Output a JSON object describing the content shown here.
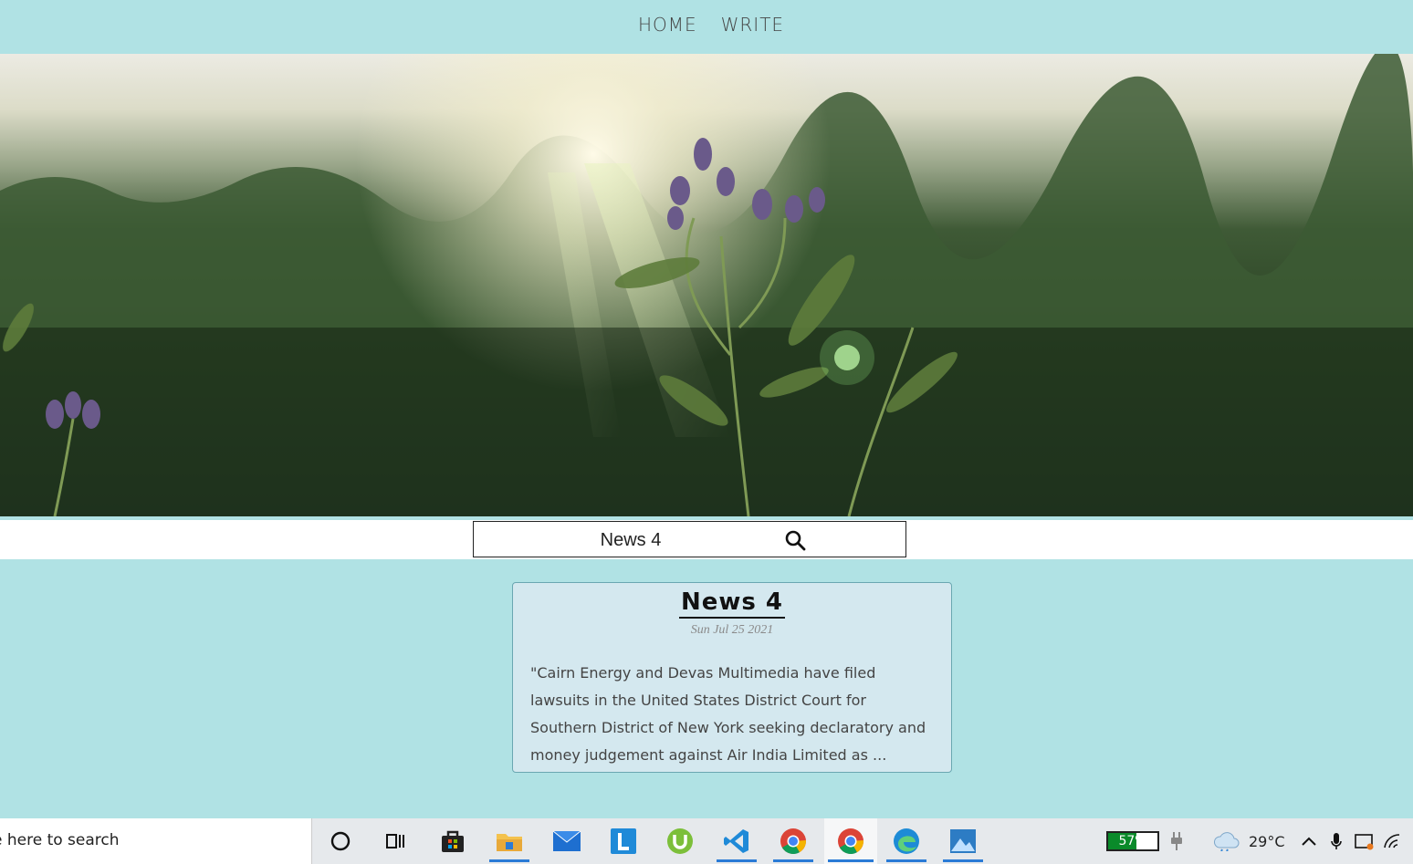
{
  "nav": {
    "home_label": "HOME",
    "write_label": "WRITE"
  },
  "search": {
    "value": "News 4"
  },
  "post": {
    "title": "News 4",
    "date": "Sun Jul 25 2021",
    "excerpt": "\"Cairn Energy and Devas Multimedia have filed lawsuits in the United States District Court for Southern District of New York seeking declaratory and money judgement against Air India Limited as ..."
  },
  "taskbar": {
    "search_placeholder": "e here to search",
    "battery_percent": 57,
    "battery_label": "57%",
    "temperature": "29°C",
    "apps": [
      "cortana-icon",
      "task-view-icon",
      "store-icon",
      "file-explorer-icon",
      "mail-icon",
      "l-app-icon",
      "utorrent-icon",
      "vscode-icon",
      "chrome-icon",
      "chrome-icon-active",
      "edge-icon",
      "photos-icon"
    ]
  },
  "colors": {
    "page_bg": "#b0e2e4",
    "card_bg": "#d4e8ef",
    "card_border": "#6aa7b1",
    "battery_fill": "#0a8a2a"
  }
}
